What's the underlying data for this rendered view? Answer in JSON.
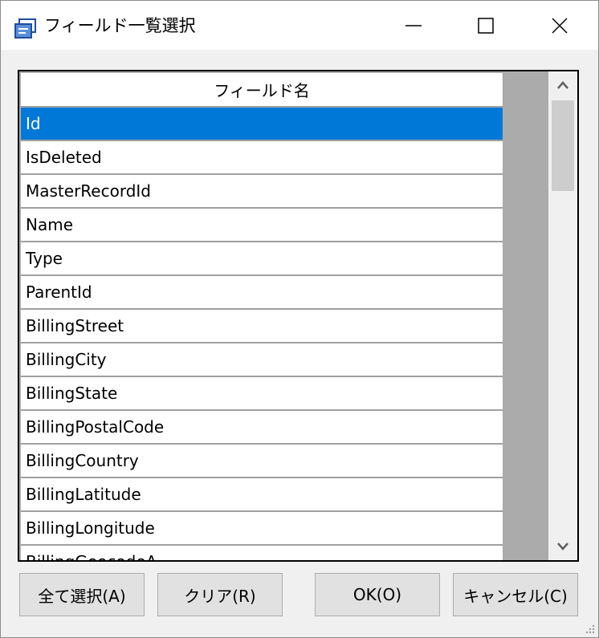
{
  "window": {
    "title": "フィールド一覧選択",
    "controls": {
      "minimize": "—",
      "maximize": "☐",
      "close": "✕"
    }
  },
  "grid": {
    "column_header": "フィールド名",
    "rows": [
      {
        "label": "Id",
        "selected": true
      },
      {
        "label": "IsDeleted"
      },
      {
        "label": "MasterRecordId"
      },
      {
        "label": "Name"
      },
      {
        "label": "Type"
      },
      {
        "label": "ParentId"
      },
      {
        "label": "BillingStreet"
      },
      {
        "label": "BillingCity"
      },
      {
        "label": "BillingState"
      },
      {
        "label": "BillingPostalCode"
      },
      {
        "label": "BillingCountry"
      },
      {
        "label": "BillingLatitude"
      },
      {
        "label": "BillingLongitude"
      },
      {
        "label": "BillingGeocodeA..."
      }
    ]
  },
  "buttons": {
    "select_all": "全て選択(A)",
    "clear": "クリア(R)",
    "ok": "OK(O)",
    "cancel": "キャンセル(C)"
  },
  "colors": {
    "selection": "#0078d7",
    "grid_background": "#ababab"
  }
}
